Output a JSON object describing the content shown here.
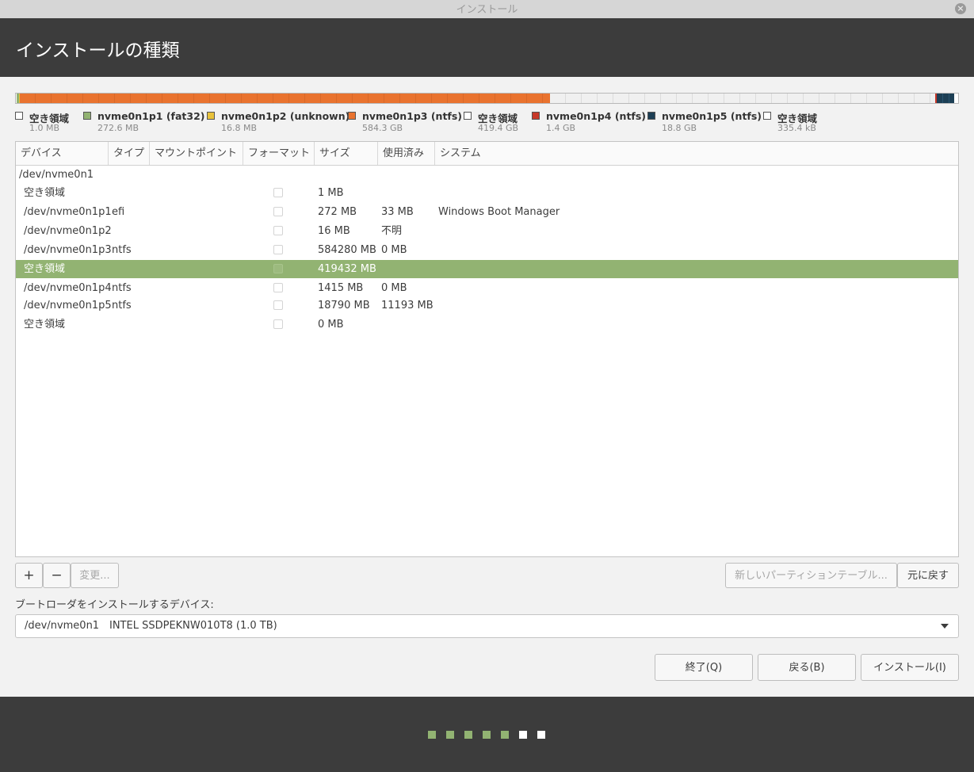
{
  "window": {
    "title": "インストール"
  },
  "header": {
    "title": "インストールの種類"
  },
  "partition_bar": [
    {
      "color": "#ffffff",
      "fraction": 0.0006
    },
    {
      "color": "#92b372",
      "fraction": 0.003
    },
    {
      "color": "#e8c23c",
      "fraction": 0.0006
    },
    {
      "color": "#e9732f",
      "fraction": 0.5628
    },
    {
      "color": "#f0f0f0",
      "fraction": 0.4088
    },
    {
      "color": "#c7392a",
      "fraction": 0.0014
    },
    {
      "color": "#1d3f55",
      "fraction": 0.0188
    },
    {
      "color": "#ffffff",
      "fraction": 0.004
    }
  ],
  "legend": [
    {
      "name": "空き領域",
      "size": "1.0 MB",
      "color": "#ffffff"
    },
    {
      "name": "nvme0n1p1 (fat32)",
      "size": "272.6 MB",
      "color": "#92b372"
    },
    {
      "name": "nvme0n1p2 (unknown)",
      "size": "16.8 MB",
      "color": "#e8c23c"
    },
    {
      "name": "nvme0n1p3 (ntfs)",
      "size": "584.3 GB",
      "color": "#e9732f"
    },
    {
      "name": "空き領域",
      "size": "419.4 GB",
      "color": "#ffffff"
    },
    {
      "name": "nvme0n1p4 (ntfs)",
      "size": "1.4 GB",
      "color": "#c7392a"
    },
    {
      "name": "nvme0n1p5 (ntfs)",
      "size": "18.8 GB",
      "color": "#1d3f55"
    },
    {
      "name": "空き領域",
      "size": "335.4 kB",
      "color": "#ffffff"
    }
  ],
  "table": {
    "columns": [
      "デバイス",
      "タイプ",
      "マウントポイント",
      "フォーマット",
      "サイズ",
      "使用済み",
      "システム"
    ],
    "disk": "/dev/nvme0n1",
    "rows": [
      {
        "device": "空き領域",
        "type": "",
        "size": "1 MB",
        "used": "",
        "system": "",
        "selected": false
      },
      {
        "device": "/dev/nvme0n1p1",
        "type": "efi",
        "size": "272 MB",
        "used": "33 MB",
        "system": "Windows Boot Manager",
        "selected": false
      },
      {
        "device": "/dev/nvme0n1p2",
        "type": "",
        "size": "16 MB",
        "used": "不明",
        "system": "",
        "selected": false
      },
      {
        "device": "/dev/nvme0n1p3",
        "type": "ntfs",
        "size": "584280 MB",
        "used": "0 MB",
        "system": "",
        "selected": false
      },
      {
        "device": "空き領域",
        "type": "",
        "size": "419432 MB",
        "used": "",
        "system": "",
        "selected": true
      },
      {
        "device": "/dev/nvme0n1p4",
        "type": "ntfs",
        "size": "1415 MB",
        "used": "0 MB",
        "system": "",
        "selected": false
      },
      {
        "device": "/dev/nvme0n1p5",
        "type": "ntfs",
        "size": "18790 MB",
        "used": "11193 MB",
        "system": "",
        "selected": false
      },
      {
        "device": "空き領域",
        "type": "",
        "size": "0 MB",
        "used": "",
        "system": "",
        "selected": false
      }
    ]
  },
  "toolbar": {
    "add": "+",
    "remove": "−",
    "change": "変更...",
    "new_table": "新しいパーティションテーブル...",
    "revert": "元に戻す"
  },
  "bootloader": {
    "label": "ブートローダをインストールするデバイス:",
    "device": "/dev/nvme0n1",
    "model": "INTEL SSDPEKNW010T8 (1.0 TB)"
  },
  "buttons": {
    "quit": "終了(Q)",
    "back": "戻る(B)",
    "install": "インストール(I)"
  },
  "progress_dots": [
    {
      "state": "done",
      "color": "#92b372"
    },
    {
      "state": "done",
      "color": "#92b372"
    },
    {
      "state": "done",
      "color": "#92b372"
    },
    {
      "state": "done",
      "color": "#92b372"
    },
    {
      "state": "done",
      "color": "#92b372"
    },
    {
      "state": "pending",
      "color": "#ffffff"
    },
    {
      "state": "pending",
      "color": "#ffffff"
    }
  ]
}
